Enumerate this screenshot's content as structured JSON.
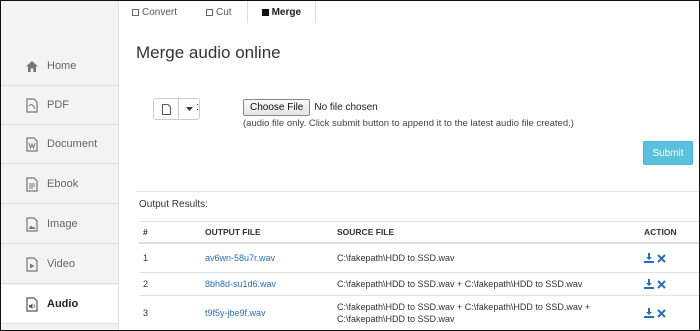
{
  "tabs": [
    {
      "label": "Convert"
    },
    {
      "label": "Cut"
    },
    {
      "label": "Merge"
    }
  ],
  "sidebar": {
    "items": [
      {
        "label": "Home",
        "icon": "home-icon"
      },
      {
        "label": "PDF",
        "icon": "pdf-icon"
      },
      {
        "label": "Document",
        "icon": "document-icon"
      },
      {
        "label": "Ebook",
        "icon": "ebook-icon"
      },
      {
        "label": "Image",
        "icon": "image-icon"
      },
      {
        "label": "Video",
        "icon": "video-icon"
      },
      {
        "label": "Audio",
        "icon": "audio-icon"
      }
    ]
  },
  "main": {
    "title": "Merge audio online",
    "colon": ":",
    "choose_file_label": "Choose File",
    "no_file_text": "No file chosen",
    "hint": "(audio file only. Click submit button to append it to the latest audio file created.)",
    "submit_label": "Submit",
    "results_label": "Output Results:"
  },
  "table": {
    "headers": {
      "num": "#",
      "output": "OUTPUT FILE",
      "source": "SOURCE FILE",
      "action": "ACTION"
    },
    "rows": [
      {
        "num": "1",
        "output": "av6wn-58u7r.wav",
        "source": "C:\\fakepath\\HDD to SSD.wav"
      },
      {
        "num": "2",
        "output": "8bh8d-su1d6.wav",
        "source": "C:\\fakepath\\HDD to SSD.wav + C:\\fakepath\\HDD to SSD.wav"
      },
      {
        "num": "3",
        "output": "t9f5y-jbe9f.wav",
        "source_line1": "C:\\fakepath\\HDD to SSD.wav + C:\\fakepath\\HDD to SSD.wav +",
        "source_line2": "C:\\fakepath\\HDD to SSD.wav"
      }
    ]
  },
  "colors": {
    "accent": "#5bc0de",
    "link": "#2a6ebb",
    "action_icon": "#2a6ebb"
  }
}
